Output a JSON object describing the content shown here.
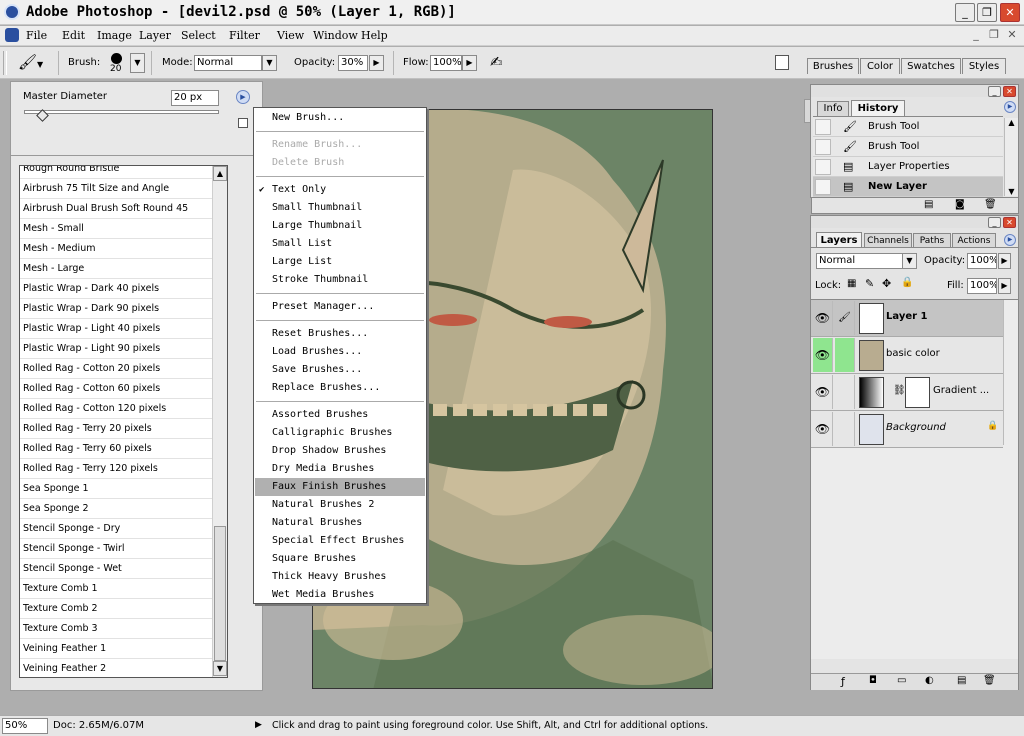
{
  "window": {
    "title": "Adobe Photoshop - [devil2.psd @ 50% (Layer 1, RGB)]"
  },
  "menubar": {
    "items": [
      "File",
      "Edit",
      "Image",
      "Layer",
      "Select",
      "Filter",
      "View",
      "Window",
      "Help"
    ]
  },
  "options": {
    "brush_label": "Brush:",
    "brush_size": "20",
    "mode_label": "Mode:",
    "mode_value": "Normal",
    "opacity_label": "Opacity:",
    "opacity_value": "30%",
    "flow_label": "Flow:",
    "flow_value": "100%"
  },
  "palette_well": {
    "tabs": [
      "Brushes",
      "Color",
      "Swatches",
      "Styles"
    ]
  },
  "brush_picker": {
    "diameter_label": "Master Diameter",
    "diameter_value": "20 px",
    "diameter_fraction": 0.09,
    "brushes": [
      "Rough Round Bristle",
      "Airbrush 75 Tilt Size and Angle",
      "Airbrush Dual Brush Soft Round 45",
      "Mesh - Small",
      "Mesh - Medium",
      "Mesh - Large",
      "Plastic Wrap - Dark 40 pixels",
      "Plastic Wrap - Dark 90 pixels",
      "Plastic Wrap - Light 40 pixels",
      "Plastic Wrap - Light 90 pixels",
      "Rolled Rag - Cotton 20 pixels",
      "Rolled Rag - Cotton 60 pixels",
      "Rolled Rag - Cotton 120 pixels",
      "Rolled Rag - Terry 20 pixels",
      "Rolled Rag - Terry 60 pixels",
      "Rolled Rag - Terry 120 pixels",
      "Sea Sponge 1",
      "Sea Sponge 2",
      "Stencil Sponge - Dry",
      "Stencil Sponge - Twirl",
      "Stencil Sponge - Wet",
      "Texture Comb 1",
      "Texture Comb 2",
      "Texture Comb 3",
      "Veining Feather 1",
      "Veining Feather 2"
    ]
  },
  "brush_menu": {
    "items": [
      {
        "label": "New Brush...",
        "state": "normal"
      },
      {
        "sep": true
      },
      {
        "label": "Rename Brush...",
        "state": "disabled"
      },
      {
        "label": "Delete Brush",
        "state": "disabled"
      },
      {
        "sep": true
      },
      {
        "label": "Text Only",
        "state": "checked"
      },
      {
        "label": "Small Thumbnail",
        "state": "normal"
      },
      {
        "label": "Large Thumbnail",
        "state": "normal"
      },
      {
        "label": "Small List",
        "state": "normal"
      },
      {
        "label": "Large List",
        "state": "normal"
      },
      {
        "label": "Stroke Thumbnail",
        "state": "normal"
      },
      {
        "sep": true
      },
      {
        "label": "Preset Manager...",
        "state": "normal"
      },
      {
        "sep": true
      },
      {
        "label": "Reset Brushes...",
        "state": "normal"
      },
      {
        "label": "Load Brushes...",
        "state": "normal"
      },
      {
        "label": "Save Brushes...",
        "state": "normal"
      },
      {
        "label": "Replace Brushes...",
        "state": "normal"
      },
      {
        "sep": true
      },
      {
        "label": "Assorted Brushes",
        "state": "normal"
      },
      {
        "label": "Calligraphic Brushes",
        "state": "normal"
      },
      {
        "label": "Drop Shadow Brushes",
        "state": "normal"
      },
      {
        "label": "Dry Media Brushes",
        "state": "normal"
      },
      {
        "label": "Faux Finish Brushes",
        "state": "highlighted"
      },
      {
        "label": "Natural Brushes 2",
        "state": "normal"
      },
      {
        "label": "Natural Brushes",
        "state": "normal"
      },
      {
        "label": "Special Effect Brushes",
        "state": "normal"
      },
      {
        "label": "Square Brushes",
        "state": "normal"
      },
      {
        "label": "Thick Heavy Brushes",
        "state": "normal"
      },
      {
        "label": "Wet Media Brushes",
        "state": "normal"
      }
    ]
  },
  "history_panel": {
    "tabs": [
      "Info",
      "History"
    ],
    "items": [
      {
        "label": "Brush Tool",
        "icon": "brush-icon"
      },
      {
        "label": "Brush Tool",
        "icon": "brush-icon"
      },
      {
        "label": "Layer Properties",
        "icon": "doc-icon"
      },
      {
        "label": "New Layer",
        "icon": "doc-icon",
        "active": true
      }
    ]
  },
  "layers_panel": {
    "tabs": [
      "Layers",
      "Channels",
      "Paths",
      "Actions"
    ],
    "blend_mode": "Normal",
    "opacity_label": "Opacity:",
    "opacity_value": "100%",
    "lock_label": "Lock:",
    "fill_label": "Fill:",
    "fill_value": "100%",
    "layers": [
      {
        "name": "Layer 1",
        "selected": true
      },
      {
        "name": "basic color"
      },
      {
        "name": "Gradient ..."
      },
      {
        "name": "Background",
        "italic": true
      }
    ]
  },
  "status": {
    "zoom": "50%",
    "doc": "Doc: 2.65M/6.07M",
    "hint": "Click and drag to paint using foreground color.  Use Shift, Alt, and Ctrl for additional options."
  },
  "colors": {
    "canvas_bg": "#6c8466",
    "highlight": "#b0b0b0",
    "eye_green": "#8fe58f"
  }
}
